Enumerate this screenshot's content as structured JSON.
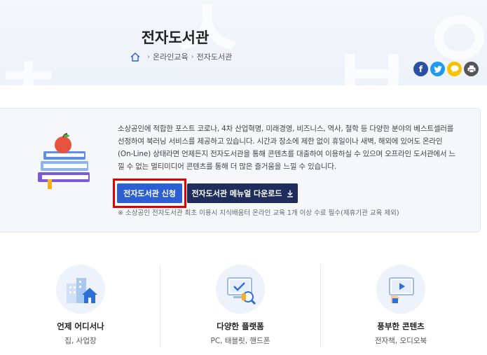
{
  "header": {
    "title": "전자도서관",
    "bg_glyphs": [
      "ㅊ",
      "ㅅ",
      "ㅂ",
      "ㅇ"
    ],
    "breadcrumb": [
      "온라인교육",
      "전자도서관"
    ]
  },
  "share": {
    "facebook": "f",
    "twitter": "t",
    "kakao": "",
    "print": ""
  },
  "intro": {
    "lines": [
      "소상공인에 적합한 포스트 코로나, 4차 산업혁명, 미래경영, 비즈니스, 역사, 철학 등 다양한 분야의 베스트셀러를",
      "선정하여 북러닝 서비스를 제공하고 있습니다. 시간과 장소에 제한 없이 휴일이나 새벽, 해외에 있어도 온라인",
      "(On-Line) 상태라면 언제든지 전자도서관을 통해 콘텐츠를 대출하여 이용하실 수 있으며 오프라인 도서관에서 느",
      "낄 수 없는 멀티미디어 콘텐츠를 통해 더 많은 즐거움을 느낄 수 있습니다."
    ],
    "apply_label": "전자도서관 신청",
    "manual_label": "전자도서관 메뉴얼 다운로드",
    "note": "※ 소상공인 전자도서관 최초 이용시 지식배움터 온라인 교육 1개 이상 수료 필수(제휴기관 교육 제외)"
  },
  "features": [
    {
      "title": "언제 어디서나",
      "sub": "집, 사업장",
      "icon": "building-icon"
    },
    {
      "title": "다양한 플랫폼",
      "sub": "PC, 태블릿, 핸드폰",
      "icon": "devices-icon"
    },
    {
      "title": "풍부한 콘텐츠",
      "sub": "전자책, 오디오북",
      "icon": "media-icon"
    }
  ],
  "colors": {
    "apply_button": "#2c5fd1",
    "manual_button": "#1f2d5c",
    "highlight_frame": "#e00000"
  }
}
